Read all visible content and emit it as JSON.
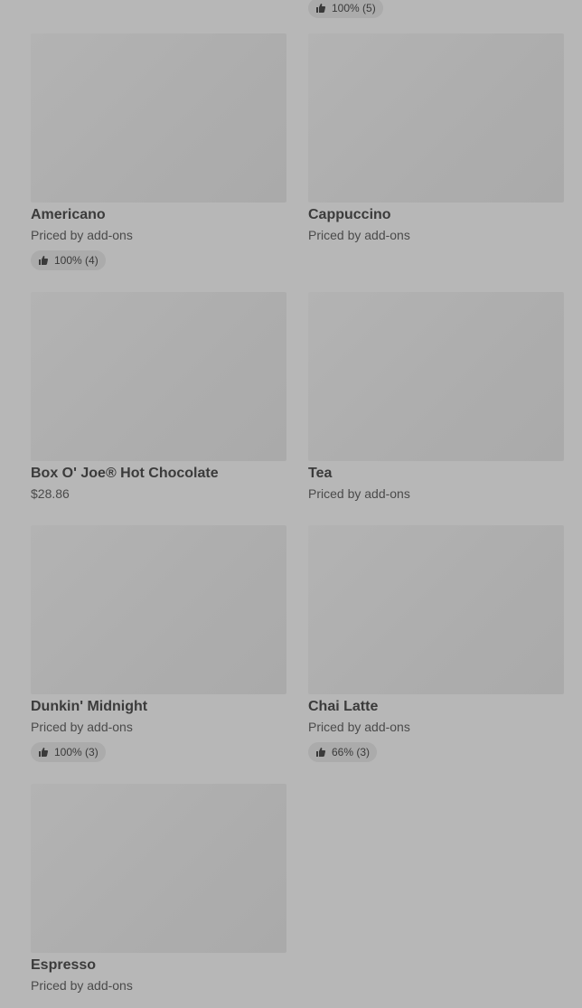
{
  "top_partial_rating": "100% (5)",
  "items": [
    {
      "name": "Americano",
      "price": "Priced by add-ons",
      "rating": "100% (4)"
    },
    {
      "name": "Cappuccino",
      "price": "Priced by add-ons",
      "rating": null
    },
    {
      "name": "Box O' Joe® Hot Chocolate",
      "price": "$28.86",
      "rating": null
    },
    {
      "name": "Tea",
      "price": "Priced by add-ons",
      "rating": null
    },
    {
      "name": "Dunkin' Midnight",
      "price": "Priced by add-ons",
      "rating": "100% (3)"
    },
    {
      "name": "Chai Latte",
      "price": "Priced by add-ons",
      "rating": "66% (3)"
    },
    {
      "name": "Espresso",
      "price": "Priced by add-ons",
      "rating": null
    }
  ],
  "icons": {
    "rating": "thumbs-up-icon"
  }
}
